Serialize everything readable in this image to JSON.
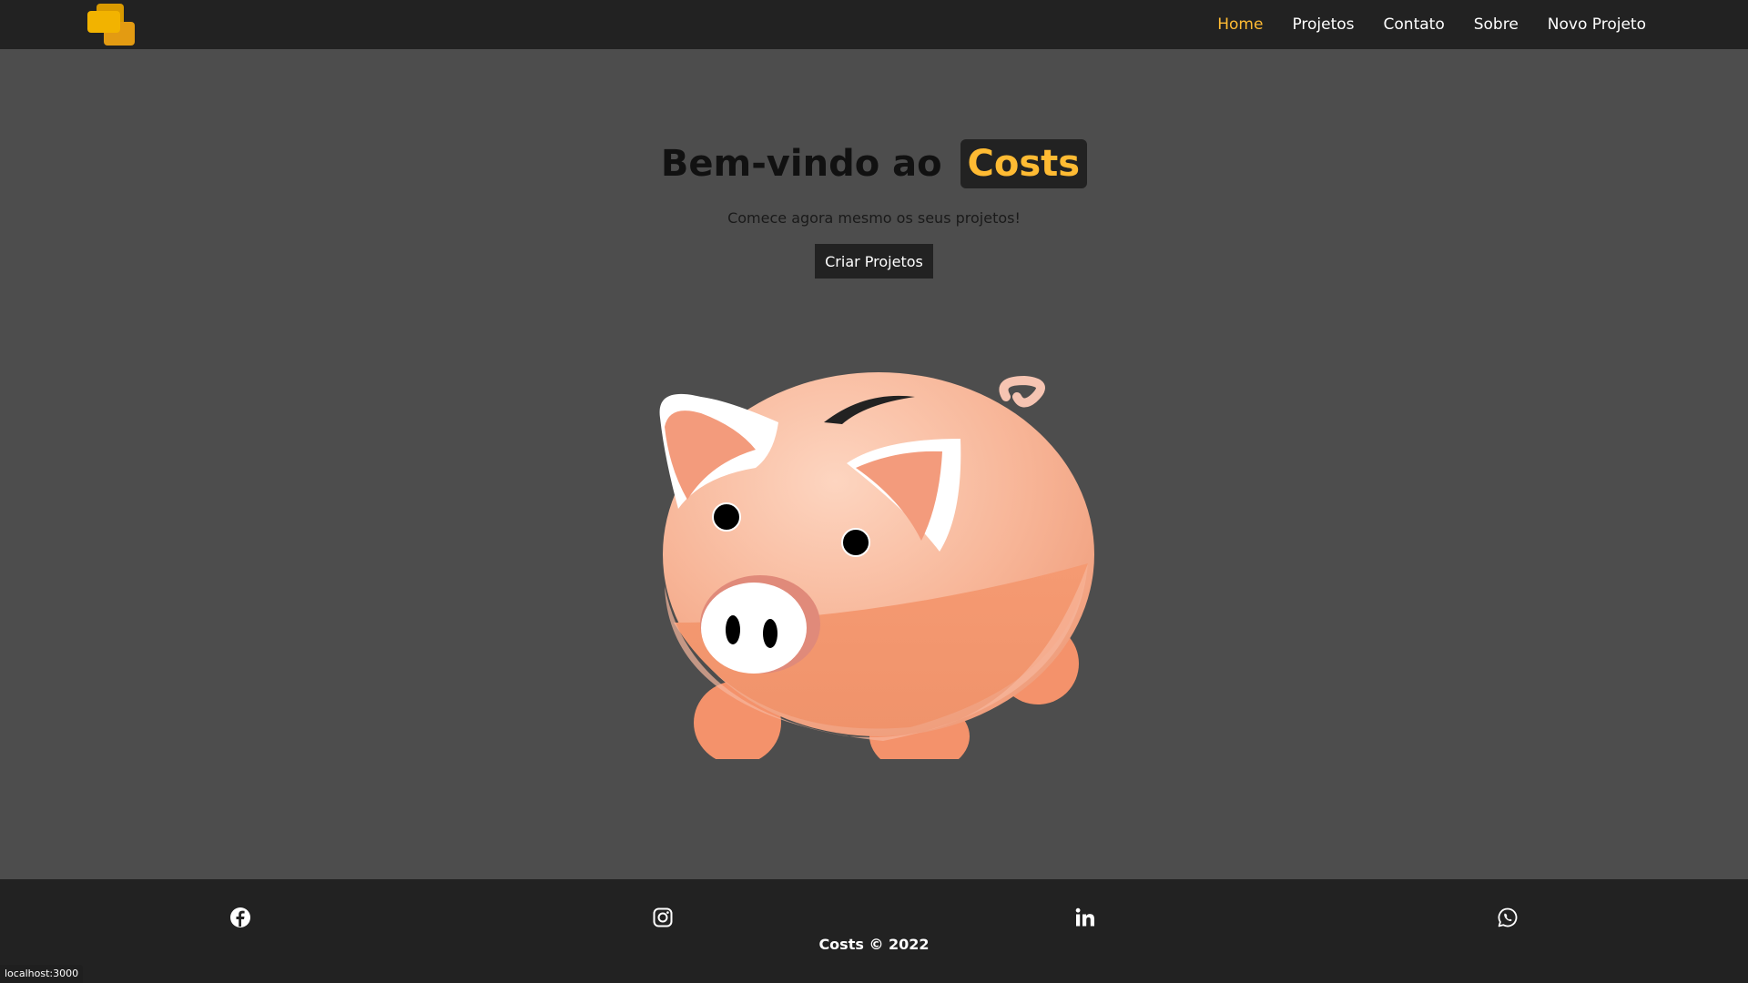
{
  "nav": {
    "logo_icon": "stacked-coins-icon",
    "links": [
      {
        "label": "Home",
        "active": true
      },
      {
        "label": "Projetos",
        "active": false
      },
      {
        "label": "Contato",
        "active": false
      },
      {
        "label": "Sobre",
        "active": false
      },
      {
        "label": "Novo Projeto",
        "active": false
      }
    ]
  },
  "hero": {
    "title_prefix": "Bem-vindo ao",
    "title_brand": "Costs",
    "subtitle": "Comece agora mesmo os seus projetos!",
    "cta_label": "Criar Projetos",
    "image_icon": "piggy-bank-icon"
  },
  "footer": {
    "social": [
      "facebook-icon",
      "instagram-icon",
      "linkedin-icon",
      "whatsapp-icon"
    ],
    "copyright": "Costs © 2022"
  },
  "status": {
    "url": "localhost:3000"
  },
  "colors": {
    "accent": "#ffbb33",
    "navbar_bg": "#222222",
    "page_bg": "#4d4d4d"
  }
}
